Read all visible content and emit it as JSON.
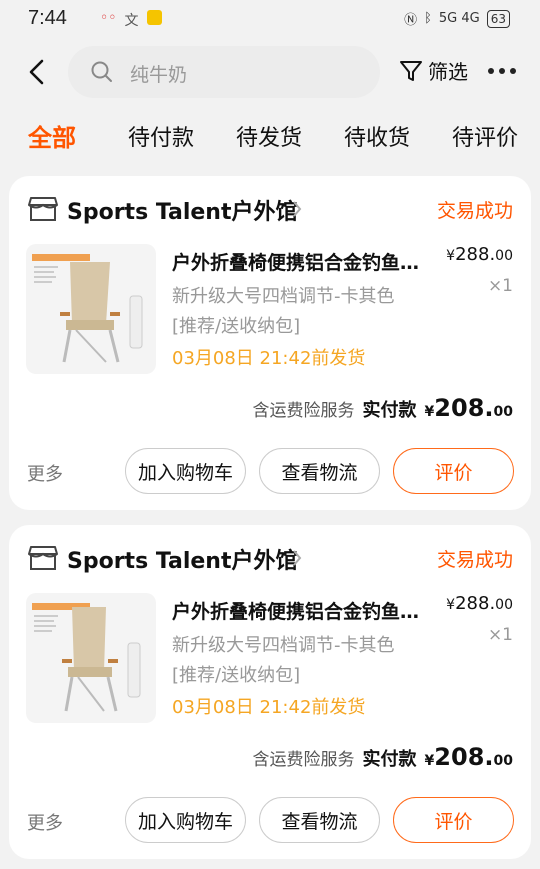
{
  "status_bar": {
    "time": "7:44",
    "left_icons": [
      "tv-icon",
      "translate-icon",
      "app-icon"
    ],
    "battery": "63",
    "network": "5G 4G"
  },
  "header": {
    "search_placeholder": "纯牛奶",
    "filter_label": "筛选"
  },
  "tabs": [
    {
      "label": "全部",
      "active": true
    },
    {
      "label": "待付款",
      "active": false
    },
    {
      "label": "待发货",
      "active": false
    },
    {
      "label": "待收货",
      "active": false
    },
    {
      "label": "待评价",
      "active": false
    }
  ],
  "orders": [
    {
      "shop_name": "Sports Talent户外馆",
      "status": "交易成功",
      "product_title": "户外折叠椅便携铝合金钓鱼椅靠背",
      "spec": "新升级大号四档调节-卡其色",
      "tag": "[推荐/送收纳包]",
      "shipping": "03月08日 21:42前发货",
      "price_currency": "¥",
      "price_int": "288.",
      "price_dec": "00",
      "quantity": "×1",
      "insurance": "含运费险服务",
      "paid_label": "实付款",
      "paid_currency": "¥",
      "paid_int": "208.",
      "paid_dec": "00",
      "more": "更多",
      "btn_cart": "加入购物车",
      "btn_logistics": "查看物流",
      "btn_review": "评价"
    },
    {
      "shop_name": "Sports Talent户外馆",
      "status": "交易成功",
      "product_title": "户外折叠椅便携铝合金钓鱼椅靠背",
      "spec": "新升级大号四档调节-卡其色",
      "tag": "[推荐/送收纳包]",
      "shipping": "03月08日 21:42前发货",
      "price_currency": "¥",
      "price_int": "288.",
      "price_dec": "00",
      "quantity": "×1",
      "insurance": "含运费险服务",
      "paid_label": "实付款",
      "paid_currency": "¥",
      "paid_int": "208.",
      "paid_dec": "00",
      "more": "更多",
      "btn_cart": "加入购物车",
      "btn_logistics": "查看物流",
      "btn_review": "评价"
    }
  ],
  "colors": {
    "accent": "#ff5500",
    "shipping": "#f5a623",
    "background": "#f2f2f2"
  }
}
